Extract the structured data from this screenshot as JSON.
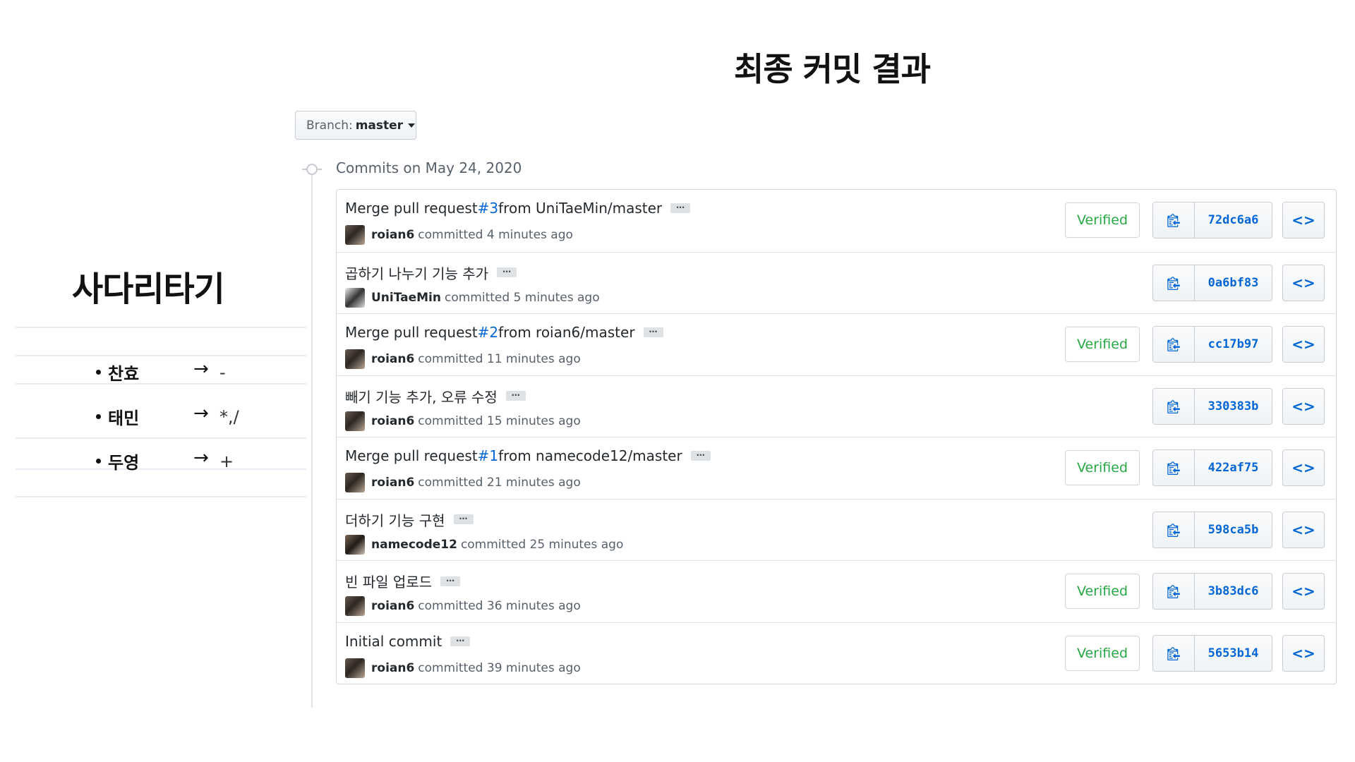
{
  "slide_title": "최종 커밋 결과",
  "left": {
    "title": "사다리타기",
    "members": [
      {
        "name": "찬효",
        "arrow": "→",
        "op": "-"
      },
      {
        "name": "태민",
        "arrow": "→",
        "op": "*,/"
      },
      {
        "name": "두영",
        "arrow": "→",
        "op": "+"
      }
    ]
  },
  "branch": {
    "label": "Branch:",
    "value": "master"
  },
  "commits_header": "Commits on May 24, 2020",
  "commits": [
    {
      "title_pre": "Merge pull request ",
      "pr": "#3",
      "title_post": " from UniTaeMin/master",
      "author": "roian6",
      "time": "committed 4 minutes ago",
      "verified": "Verified",
      "sha": "72dc6a6"
    },
    {
      "title_pre": "곱하기 나누기 기능 추가",
      "pr": "",
      "title_post": "",
      "author": "UniTaeMin",
      "time": "committed 5 minutes ago",
      "verified": "",
      "sha": "0a6bf83"
    },
    {
      "title_pre": "Merge pull request ",
      "pr": "#2",
      "title_post": " from roian6/master",
      "author": "roian6",
      "time": "committed 11 minutes ago",
      "verified": "Verified",
      "sha": "cc17b97"
    },
    {
      "title_pre": "빼기 기능 추가, 오류 수정",
      "pr": "",
      "title_post": "",
      "author": "roian6",
      "time": "committed 15 minutes ago",
      "verified": "",
      "sha": "330383b"
    },
    {
      "title_pre": "Merge pull request ",
      "pr": "#1",
      "title_post": " from namecode12/master",
      "author": "roian6",
      "time": "committed 21 minutes ago",
      "verified": "Verified",
      "sha": "422af75"
    },
    {
      "title_pre": "더하기 기능 구현",
      "pr": "",
      "title_post": "",
      "author": "namecode12",
      "time": "committed 25 minutes ago",
      "verified": "",
      "sha": "598ca5b"
    },
    {
      "title_pre": "빈 파일 업로드",
      "pr": "",
      "title_post": "",
      "author": "roian6",
      "time": "committed 36 minutes ago",
      "verified": "Verified",
      "sha": "3b83dc6"
    },
    {
      "title_pre": "Initial commit",
      "pr": "",
      "title_post": "",
      "author": "roian6",
      "time": "committed 39 minutes ago",
      "verified": "Verified",
      "sha": "5653b14"
    }
  ],
  "icons": {
    "copy": "clipboard-icon",
    "browse": "code-brackets-icon",
    "ellipsis": "ellipsis-icon"
  },
  "browse_glyph": "<>",
  "ellipsis_glyph": "…"
}
